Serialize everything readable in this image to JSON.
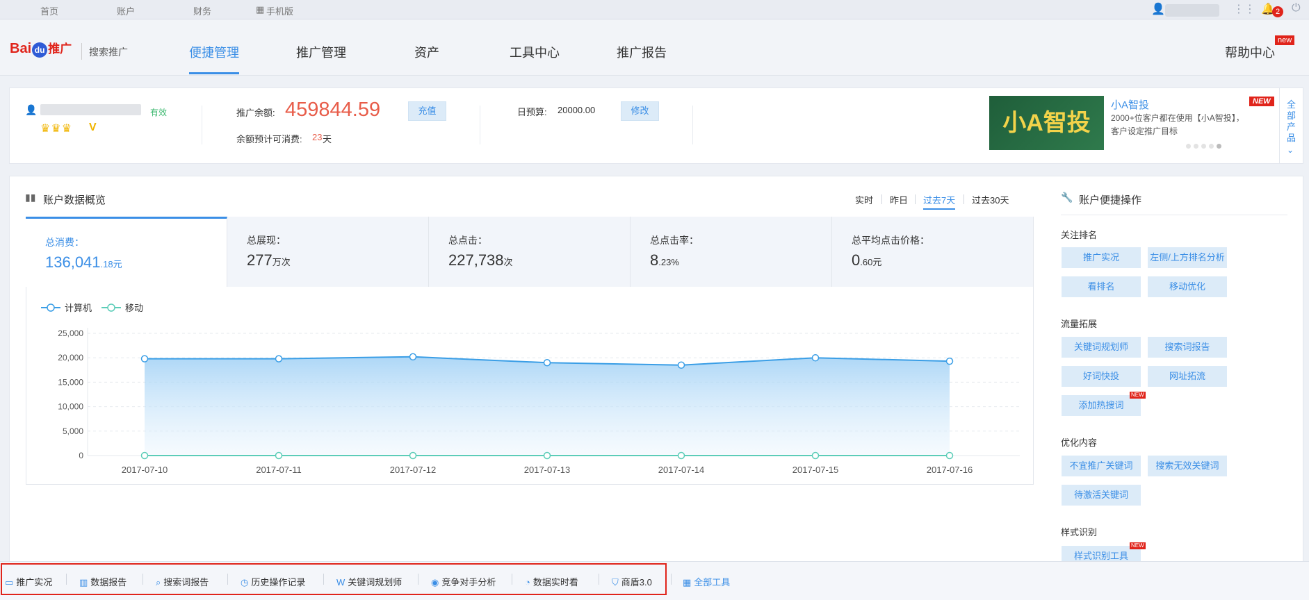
{
  "topbar": {
    "links": [
      "首页",
      "账户",
      "财务",
      "手机版"
    ],
    "notifications_count": "2"
  },
  "nav": {
    "logo_text": "Bai",
    "logo_du": "du",
    "logo_tuiguang": "推广",
    "logo_subtitle": "搜索推广",
    "items": [
      "便捷管理",
      "推广管理",
      "资产",
      "工具中心",
      "推广报告"
    ],
    "active_index": 0,
    "help_label": "帮助中心",
    "help_badge": "new"
  },
  "account": {
    "status": "有效",
    "balance_label": "推广余额:",
    "balance_value": "459844.59",
    "recharge_label": "充值",
    "remaining_label": "余额预计可消费:",
    "remaining_days": "23",
    "remaining_unit": "天",
    "budget_label": "日预算:",
    "budget_value": "20000.00",
    "modify_label": "修改"
  },
  "promo": {
    "banner_text": "小A智投",
    "title": "小A智投",
    "desc_line1": "2000+位客户都在使用【小A智投】，",
    "desc_line2": "客户设定推广目标",
    "new_tag": "NEW",
    "side_text": "全部产品"
  },
  "overview": {
    "title": "账户数据概览",
    "ranges": [
      "实时",
      "昨日",
      "过去7天",
      "过去30天"
    ],
    "active_range": 2,
    "metrics": [
      {
        "title": "总消费：",
        "main": "136,041",
        "sub": ".18元"
      },
      {
        "title": "总展现：",
        "main": "277",
        "sub": "万次"
      },
      {
        "title": "总点击：",
        "main": "227,738",
        "sub": "次"
      },
      {
        "title": "总点击率：",
        "main": "8",
        "sub": ".23%"
      },
      {
        "title": "总平均点击价格：",
        "main": "0",
        "sub": ".60元"
      }
    ]
  },
  "chart_data": {
    "type": "area",
    "categories": [
      "2017-07-10",
      "2017-07-11",
      "2017-07-12",
      "2017-07-13",
      "2017-07-14",
      "2017-07-15",
      "2017-07-16"
    ],
    "series": [
      {
        "name": "计算机",
        "values": [
          19800,
          19800,
          20200,
          19000,
          18500,
          20000,
          19300
        ],
        "color": "#3a9ee6"
      },
      {
        "name": "移动",
        "values": [
          0,
          0,
          0,
          0,
          0,
          0,
          0
        ],
        "color": "#5ccdb8"
      }
    ],
    "ylim": [
      0,
      25000
    ],
    "yticks": [
      "25,000",
      "20,000",
      "15,000",
      "10,000",
      "5,000",
      "0"
    ],
    "yticks_values": [
      25000,
      20000,
      15000,
      10000,
      5000,
      0
    ],
    "legend": "top-left",
    "grid": true
  },
  "quick_ops": {
    "title": "账户便捷操作",
    "sections": [
      {
        "title": "关注排名",
        "items": [
          "推广实况",
          "左侧/上方排名分析",
          "看排名",
          "移动优化"
        ]
      },
      {
        "title": "流量拓展",
        "items": [
          "关键词规划师",
          "搜索词报告",
          "好词快投",
          "网址拓流",
          "添加热搜词"
        ]
      },
      {
        "title": "优化内容",
        "items": [
          "不宜推广关键词",
          "搜索无效关键词",
          "待激活关键词"
        ]
      },
      {
        "title": "样式识别",
        "items": [
          "样式识别工具"
        ]
      }
    ],
    "new_tag": "NEW"
  },
  "bottom_tools": {
    "items": [
      "推广实况",
      "数据报告",
      "搜索词报告",
      "历史操作记录",
      "关键词规划师",
      "竞争对手分析",
      "数据实时看",
      "商盾3.0"
    ],
    "all_tools": "全部工具"
  }
}
